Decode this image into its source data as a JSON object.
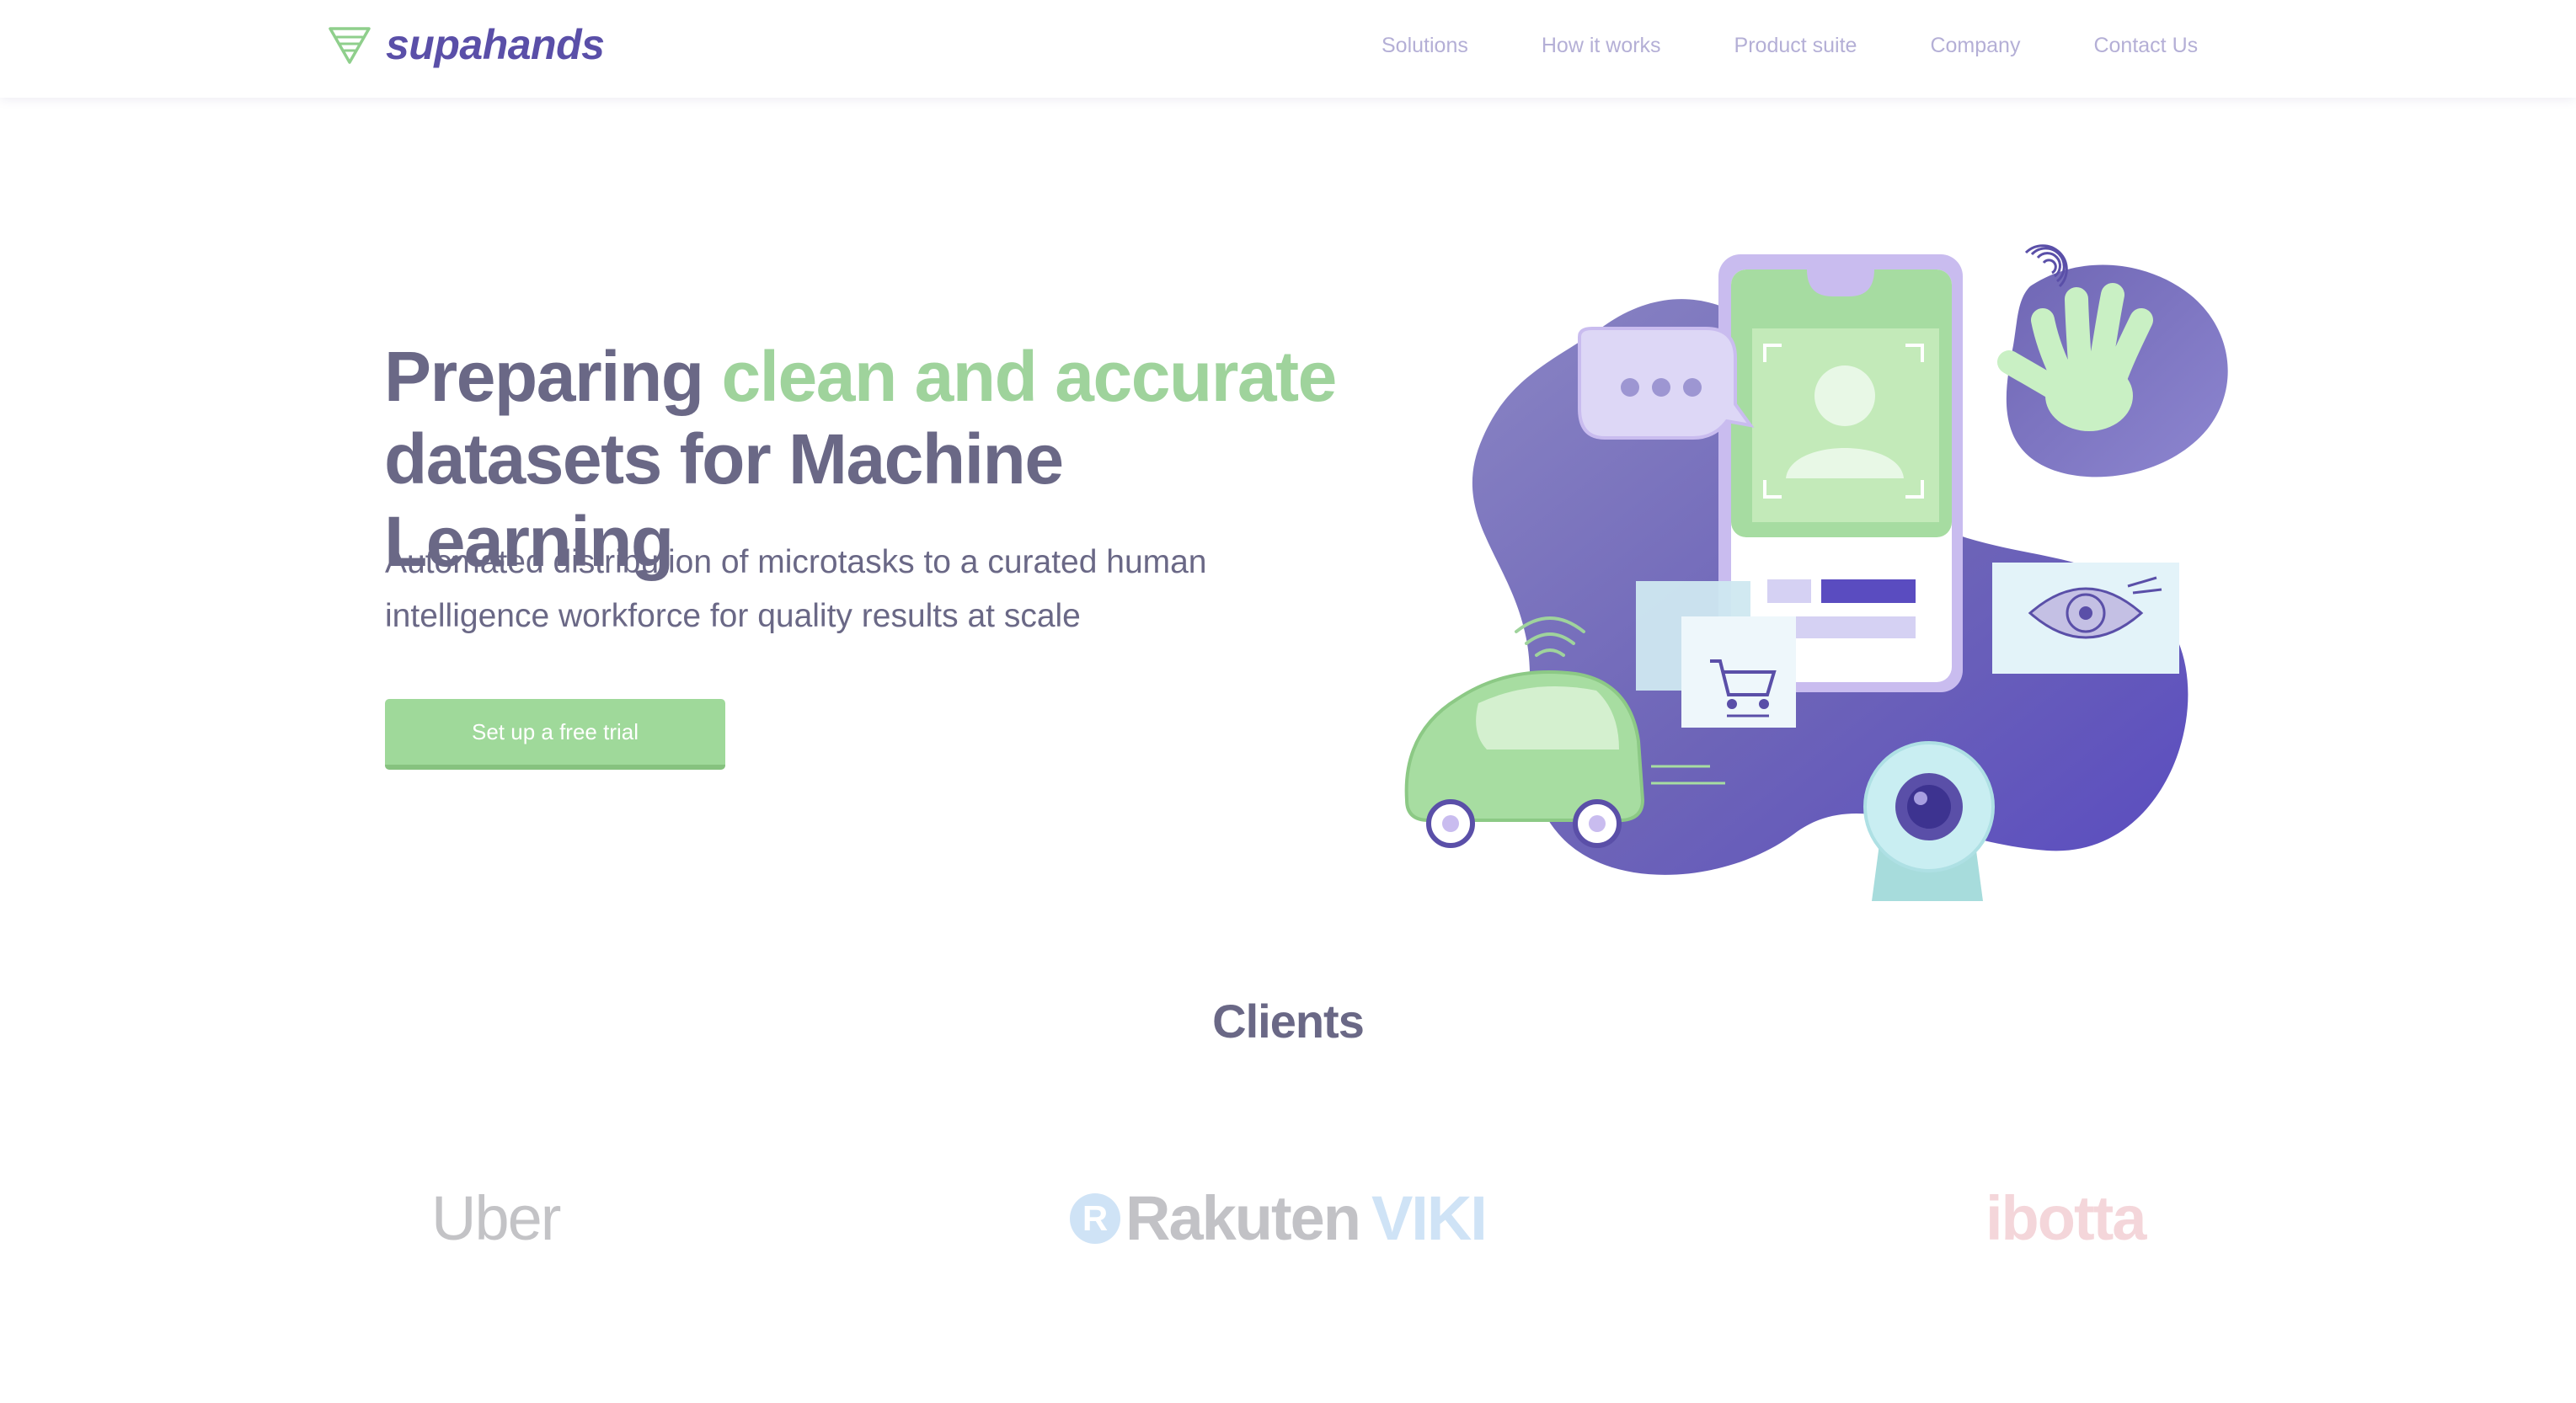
{
  "brand": {
    "name": "supahands"
  },
  "nav": {
    "items": [
      {
        "label": "Solutions"
      },
      {
        "label": "How it works"
      },
      {
        "label": "Product suite"
      },
      {
        "label": "Company"
      },
      {
        "label": "Contact Us"
      }
    ]
  },
  "hero": {
    "title_part1": "Preparing ",
    "title_accent": "clean and accurate",
    "title_part2": "datasets for Machine Learning",
    "subtitle": "Automated distribution of microtasks to a curated human intelligence workforce for quality results at scale",
    "cta_label": "Set up a free trial"
  },
  "clients": {
    "title": "Clients",
    "logos": [
      {
        "name": "Uber",
        "text": "Uber"
      },
      {
        "name": "Rakuten VIKI",
        "mark": "R",
        "word": "Rakuten",
        "sub": "VIKI"
      },
      {
        "name": "ibotta",
        "text": "ibotta"
      }
    ]
  },
  "colors": {
    "brand_purple": "#5a4fa8",
    "accent_green": "#9fd39c",
    "text": "#6a6886",
    "nav": "#b4afd6"
  },
  "icons": [
    "logo-hand-icon",
    "fingerprint-icon",
    "chat-bubble-icon",
    "face-scan-icon",
    "shopping-cart-icon",
    "eye-icon",
    "wifi-icon",
    "webcam-icon",
    "car-icon"
  ]
}
